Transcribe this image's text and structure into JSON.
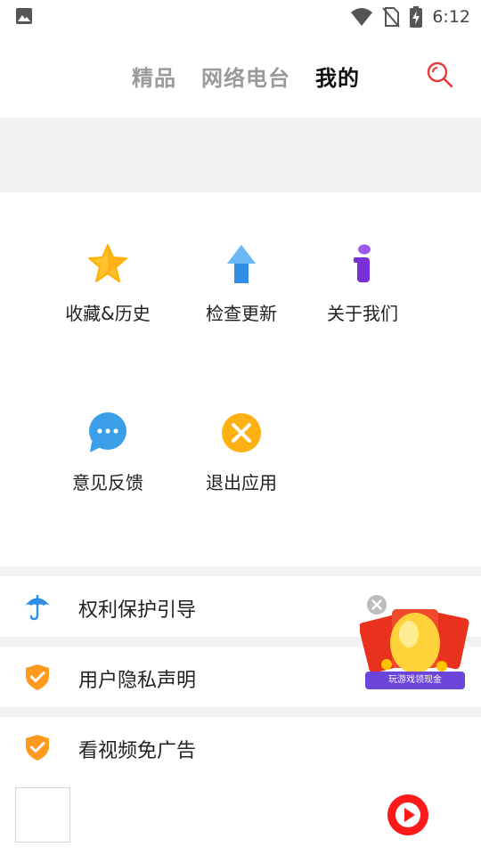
{
  "status_bar": {
    "time": "6:12",
    "icons": [
      "image-icon",
      "wifi-icon",
      "no-sim-icon",
      "battery-charging-icon"
    ]
  },
  "header": {
    "tabs": [
      {
        "label": "精品",
        "active": false
      },
      {
        "label": "网络电台",
        "active": false
      },
      {
        "label": "我的",
        "active": true
      }
    ],
    "search_icon": "search-icon",
    "accent_color": "#e53935"
  },
  "grid": {
    "items": [
      {
        "label": "收藏&历史",
        "icon": "star-icon"
      },
      {
        "label": "检查更新",
        "icon": "arrow-up-icon"
      },
      {
        "label": "关于我们",
        "icon": "info-icon"
      },
      {
        "label": "意见反馈",
        "icon": "chat-bubble-icon"
      },
      {
        "label": "退出应用",
        "icon": "close-circle-icon"
      }
    ]
  },
  "list": {
    "items": [
      {
        "label": "权利保护引导",
        "icon": "umbrella-icon"
      },
      {
        "label": "用户隐私声明",
        "icon": "shield-check-icon"
      },
      {
        "label": "看视频免广告",
        "icon": "shield-check-icon"
      }
    ]
  },
  "ad": {
    "caption": "玩游戏领现金",
    "close_icon": "close-icon"
  },
  "bottom": {
    "play_icon": "play-icon",
    "play_color": "#ff1a1a"
  }
}
